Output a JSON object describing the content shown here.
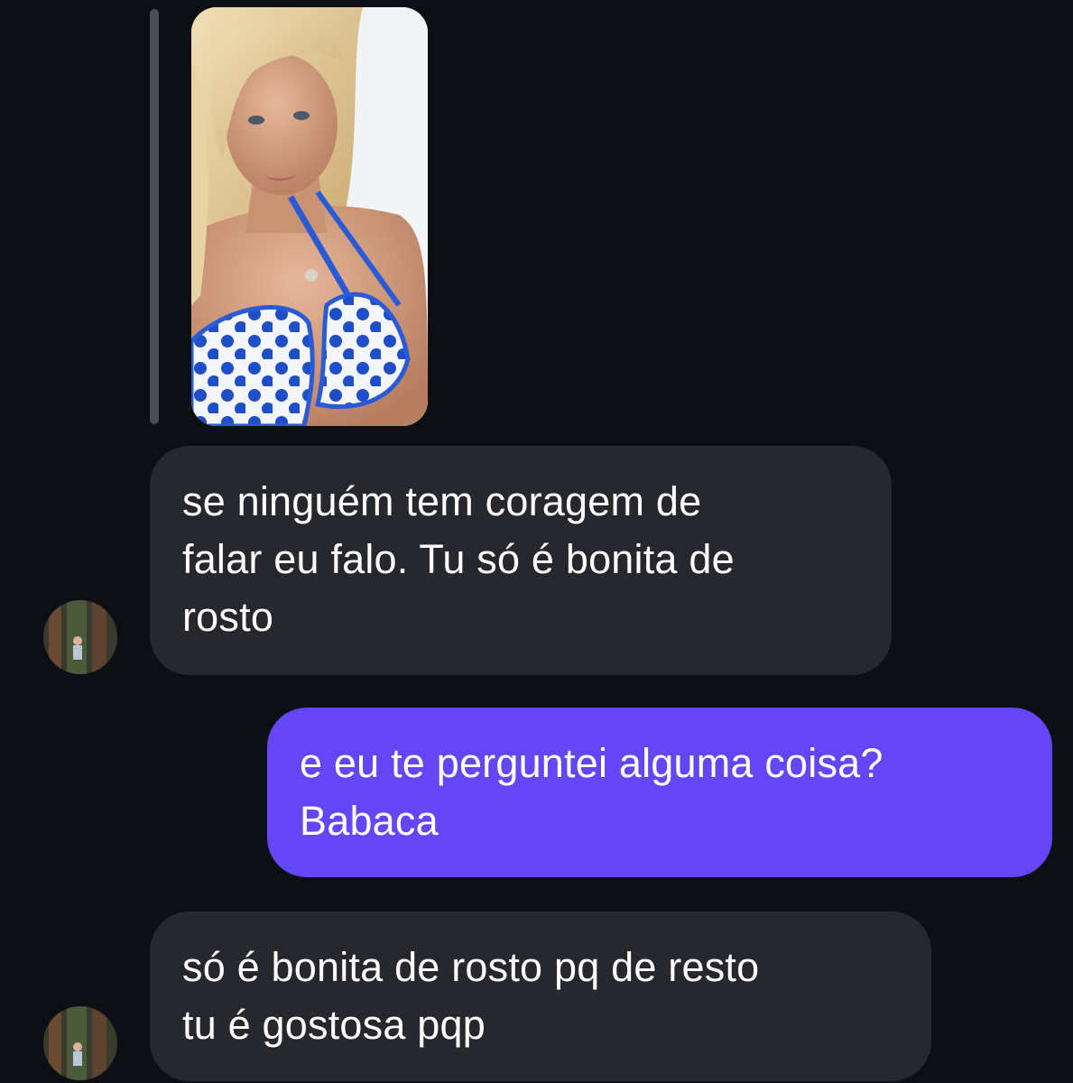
{
  "conversation": {
    "messages": [
      {
        "direction": "received",
        "text": "se ninguém tem coragem de\nfalar eu falo. Tu só é bonita de\nrosto"
      },
      {
        "direction": "sent",
        "text": "e eu te perguntei alguma coisa?\nBabaca"
      },
      {
        "direction": "received",
        "text": "só é bonita de rosto pq de resto\ntu é gostosa pqp"
      }
    ]
  },
  "colors": {
    "background": "#0c0f14",
    "received_bubble": "#26282d",
    "sent_bubble": "#6546f6",
    "text": "#ffffff",
    "reply_bar": "#4a4d54"
  },
  "icons": {
    "story_image": "story-photo",
    "avatar": "user-avatar-photo"
  }
}
